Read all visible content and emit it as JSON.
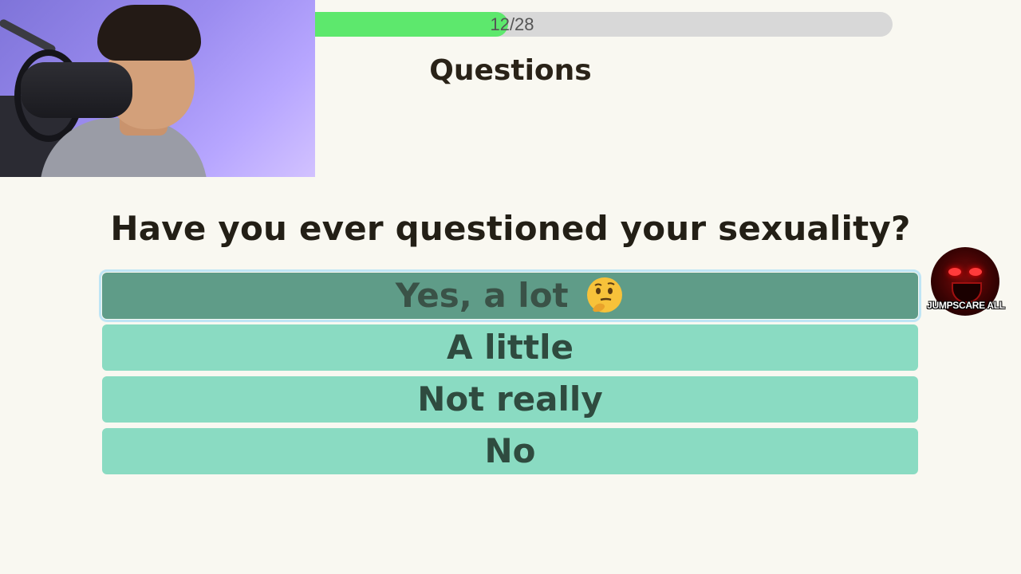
{
  "progress": {
    "text": "12/28",
    "value": 12,
    "total": 28,
    "fill_color": "#5de86d",
    "track_color": "#d8d8d8"
  },
  "header": {
    "title": "Questions"
  },
  "question": {
    "text": "Have you ever questioned your sexuality?"
  },
  "answers": [
    {
      "label": "Yes, a lot",
      "emoji": "thinking-face-icon",
      "selected": true
    },
    {
      "label": "A little",
      "selected": false
    },
    {
      "label": "Not really",
      "selected": false
    },
    {
      "label": "No",
      "selected": false
    }
  ],
  "jumpscare_badge": {
    "label": "JUMPSCARE ALL",
    "icon": "scary-face-icon"
  },
  "webcam": {
    "icon": "streamer-webcam"
  },
  "colors": {
    "background": "#f9f8f1",
    "answer": "#8adbc2",
    "answer_selected": "#5f9c88",
    "text_dark": "#231f16"
  }
}
